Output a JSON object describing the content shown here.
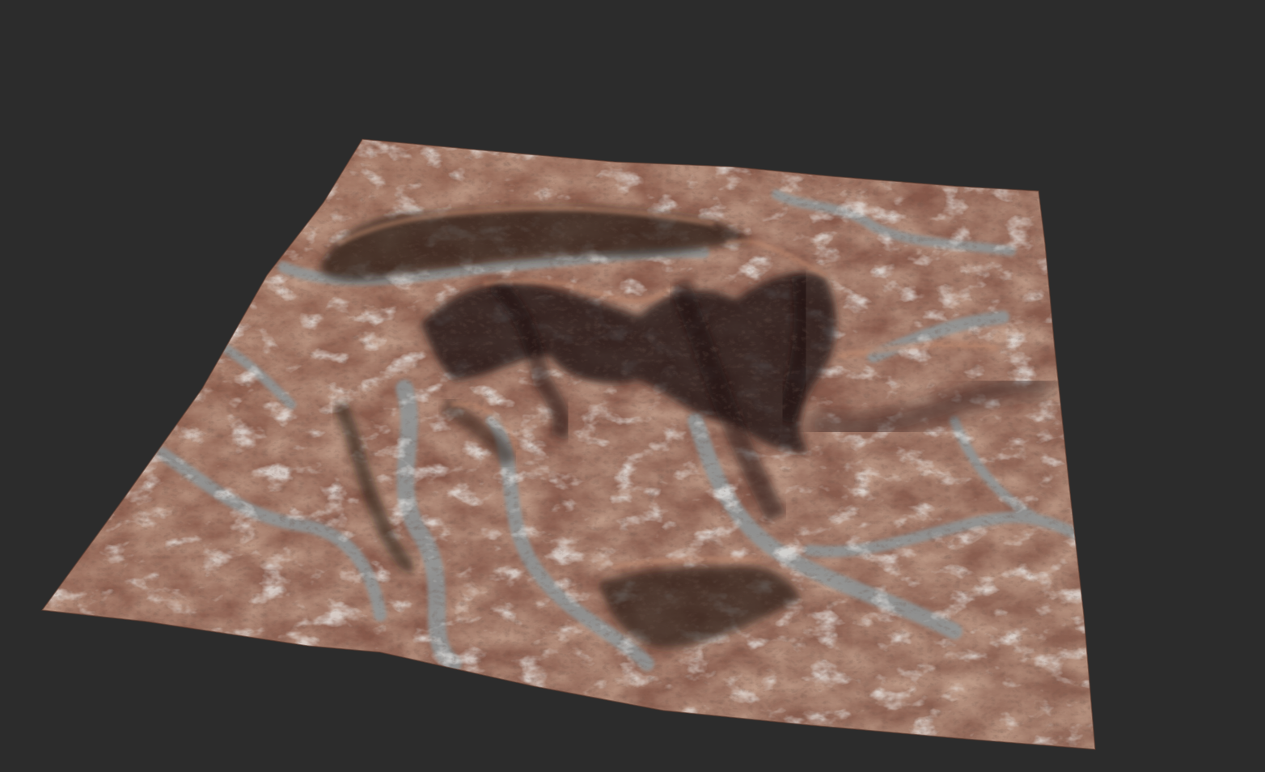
{
  "viewport": {
    "background_color": "#2c2c2c"
  },
  "terrain": {
    "palette": {
      "rock_base": "#8a5a44",
      "rock_light": "#b07a60",
      "rock_dark": "#3a241c",
      "shadow": "#1e1310",
      "snow": "#c9c3bd",
      "river_silt": "#8f9698"
    }
  }
}
